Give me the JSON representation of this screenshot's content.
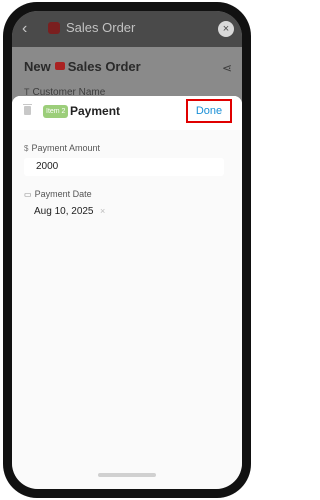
{
  "topbar": {
    "back": "‹",
    "title": "Sales Order",
    "close": "×"
  },
  "form": {
    "title_prefix": "New",
    "title_text": "Sales Order",
    "share": "⋖",
    "field_hint_icon": "T",
    "field_hint": "Customer Name"
  },
  "sheet": {
    "badge": "Item 2",
    "title": "Payment",
    "done_label": "Done",
    "fields": [
      {
        "icon": "$",
        "label": "Payment Amount",
        "value": "2000"
      },
      {
        "icon": "▭",
        "label": "Payment Date",
        "value": "Aug 10, 2025",
        "clear": "×"
      }
    ]
  },
  "colors": {
    "accent": "#1a8fd6",
    "highlight": "#e00000",
    "badge": "#9cce7a"
  }
}
